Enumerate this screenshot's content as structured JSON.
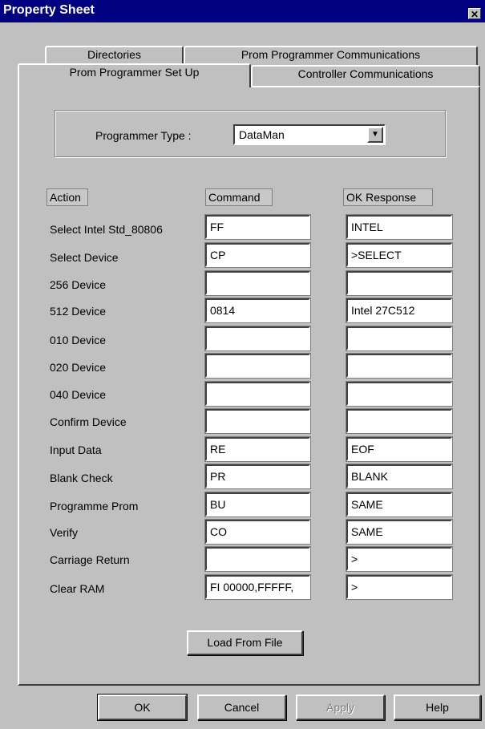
{
  "window": {
    "title": "Property Sheet",
    "close_glyph": "✕"
  },
  "tabs": {
    "back": [
      "Directories",
      "Prom Programmer Communications"
    ],
    "front": [
      "Prom Programmer Set Up",
      "Controller Communications"
    ],
    "active": "Prom Programmer Set Up"
  },
  "programmer": {
    "label": "Programmer Type :",
    "value": "DataMan",
    "dropdown_glyph": "▼"
  },
  "table": {
    "headers": {
      "action": "Action",
      "command": "Command",
      "ok_response": "OK Response"
    },
    "rows": [
      {
        "action": "Select Intel Std_80806",
        "command": "FF",
        "response": "INTEL"
      },
      {
        "action": "Select Device",
        "command": "CP",
        "response": ">SELECT"
      },
      {
        "action": "256 Device",
        "command": "",
        "response": ""
      },
      {
        "action": "512 Device",
        "command": "0814",
        "response": "Intel 27C512"
      },
      {
        "action": "010 Device",
        "command": "",
        "response": ""
      },
      {
        "action": "020 Device",
        "command": "",
        "response": ""
      },
      {
        "action": "040 Device",
        "command": "",
        "response": ""
      },
      {
        "action": "Confirm Device",
        "command": "",
        "response": ""
      },
      {
        "action": "Input Data",
        "command": "RE",
        "response": "EOF"
      },
      {
        "action": "Blank Check",
        "command": "PR",
        "response": "BLANK"
      },
      {
        "action": "Programme Prom",
        "command": "BU",
        "response": "SAME"
      },
      {
        "action": "Verify",
        "command": "CO",
        "response": "SAME"
      },
      {
        "action": "Carriage Return",
        "command": "",
        "response": ">"
      },
      {
        "action": "Clear RAM",
        "command": "FI 00000,FFFFF,",
        "response": ">"
      }
    ]
  },
  "load_button": "Load From File",
  "footer": {
    "ok": "OK",
    "cancel": "Cancel",
    "apply": "Apply",
    "help": "Help"
  }
}
